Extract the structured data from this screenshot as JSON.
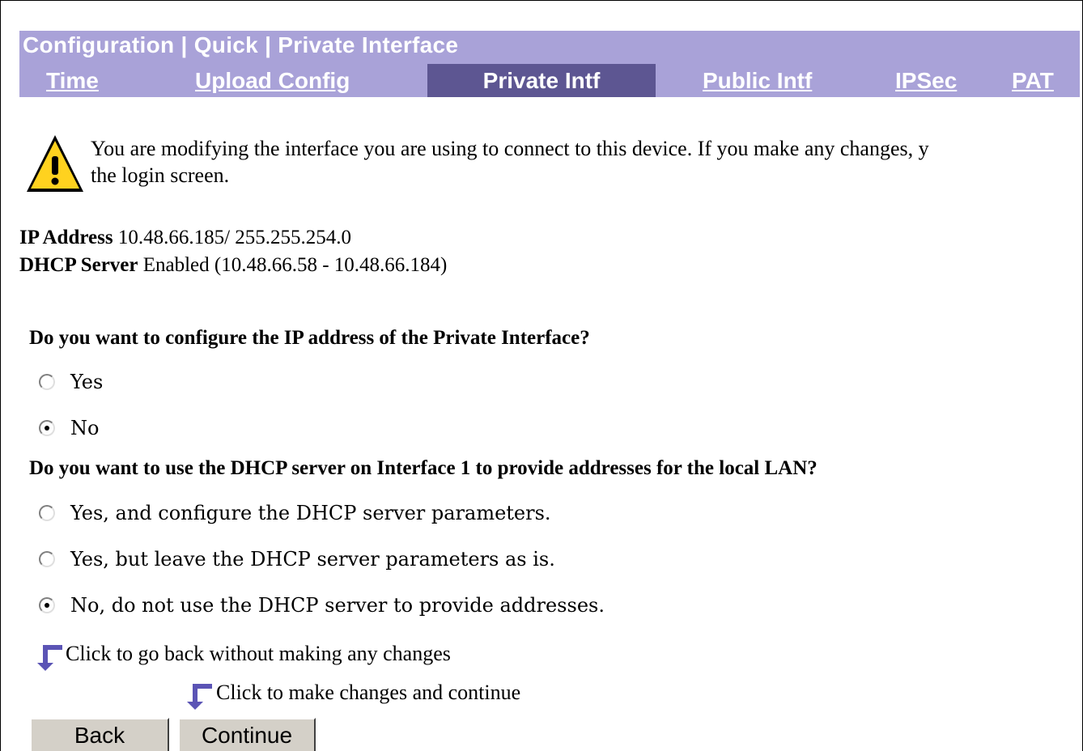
{
  "header": {
    "title": "Configuration | Quick | Private Interface",
    "tabs": [
      {
        "label": "Time",
        "active": false
      },
      {
        "label": "Upload Config",
        "active": false
      },
      {
        "label": "Private Intf",
        "active": true
      },
      {
        "label": "Public Intf",
        "active": false
      },
      {
        "label": "IPSec",
        "active": false
      },
      {
        "label": "PAT",
        "active": false
      }
    ]
  },
  "warning": {
    "icon": "warning-triangle-icon",
    "line1": "You are modifying the interface you are using to connect to this device. If you make any changes, y",
    "line2": "the login screen."
  },
  "info": {
    "ip_label": "IP Address",
    "ip_value": "10.48.66.185/ 255.255.254.0",
    "dhcp_label": "DHCP Server",
    "dhcp_value": "Enabled (10.48.66.58 - 10.48.66.184)"
  },
  "q1": {
    "text": "Do you want to configure the IP address of the Private Interface?",
    "options": [
      {
        "label": "Yes",
        "checked": false
      },
      {
        "label": "No",
        "checked": true
      }
    ]
  },
  "q2": {
    "text": "Do you want to use the DHCP server on Interface 1 to provide addresses for the local LAN?",
    "options": [
      {
        "label": "Yes, and configure the DHCP server parameters.",
        "checked": false
      },
      {
        "label": "Yes, but leave the DHCP server parameters as is.",
        "checked": false
      },
      {
        "label": "No, do not use the DHCP server to provide addresses.",
        "checked": true
      }
    ]
  },
  "hints": {
    "back": "Click to go back without making any changes",
    "continue": "Click to make changes and continue",
    "icon": "down-arrow-icon"
  },
  "buttons": {
    "back": "Back",
    "continue": "Continue"
  },
  "colors": {
    "header_bg": "#a9a2d8",
    "active_tab_bg": "#5d5692",
    "arrow": "#5b54b5"
  }
}
